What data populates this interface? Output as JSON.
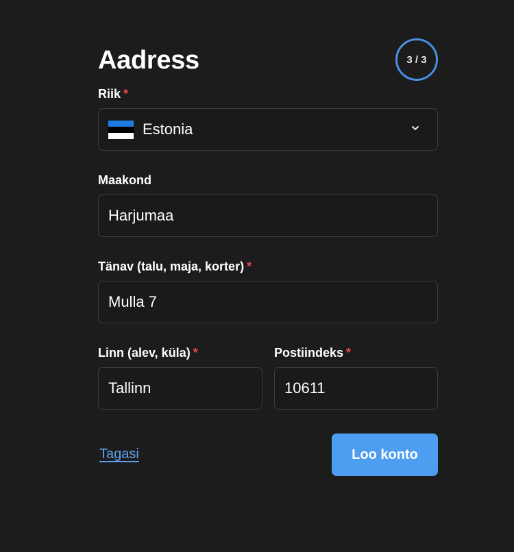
{
  "header": {
    "title": "Aadress",
    "step": "3 / 3"
  },
  "fields": {
    "country": {
      "label": "Riik",
      "required_mark": "*",
      "value": "Estonia",
      "flag": "estonia-flag"
    },
    "county": {
      "label": "Maakond",
      "value": "Harjumaa"
    },
    "street": {
      "label": "Tänav (talu, maja, korter)",
      "required_mark": "*",
      "value": "Mulla 7"
    },
    "city": {
      "label": "Linn (alev, küla)",
      "required_mark": "*",
      "value": "Tallinn"
    },
    "postal": {
      "label": "Postiindeks",
      "required_mark": "*",
      "value": "10611"
    }
  },
  "actions": {
    "back_label": "Tagasi",
    "submit_label": "Loo konto"
  },
  "colors": {
    "background": "#1c1c1d",
    "accent": "#4d9df0",
    "required": "#e5484d",
    "border": "#3a3d44"
  }
}
